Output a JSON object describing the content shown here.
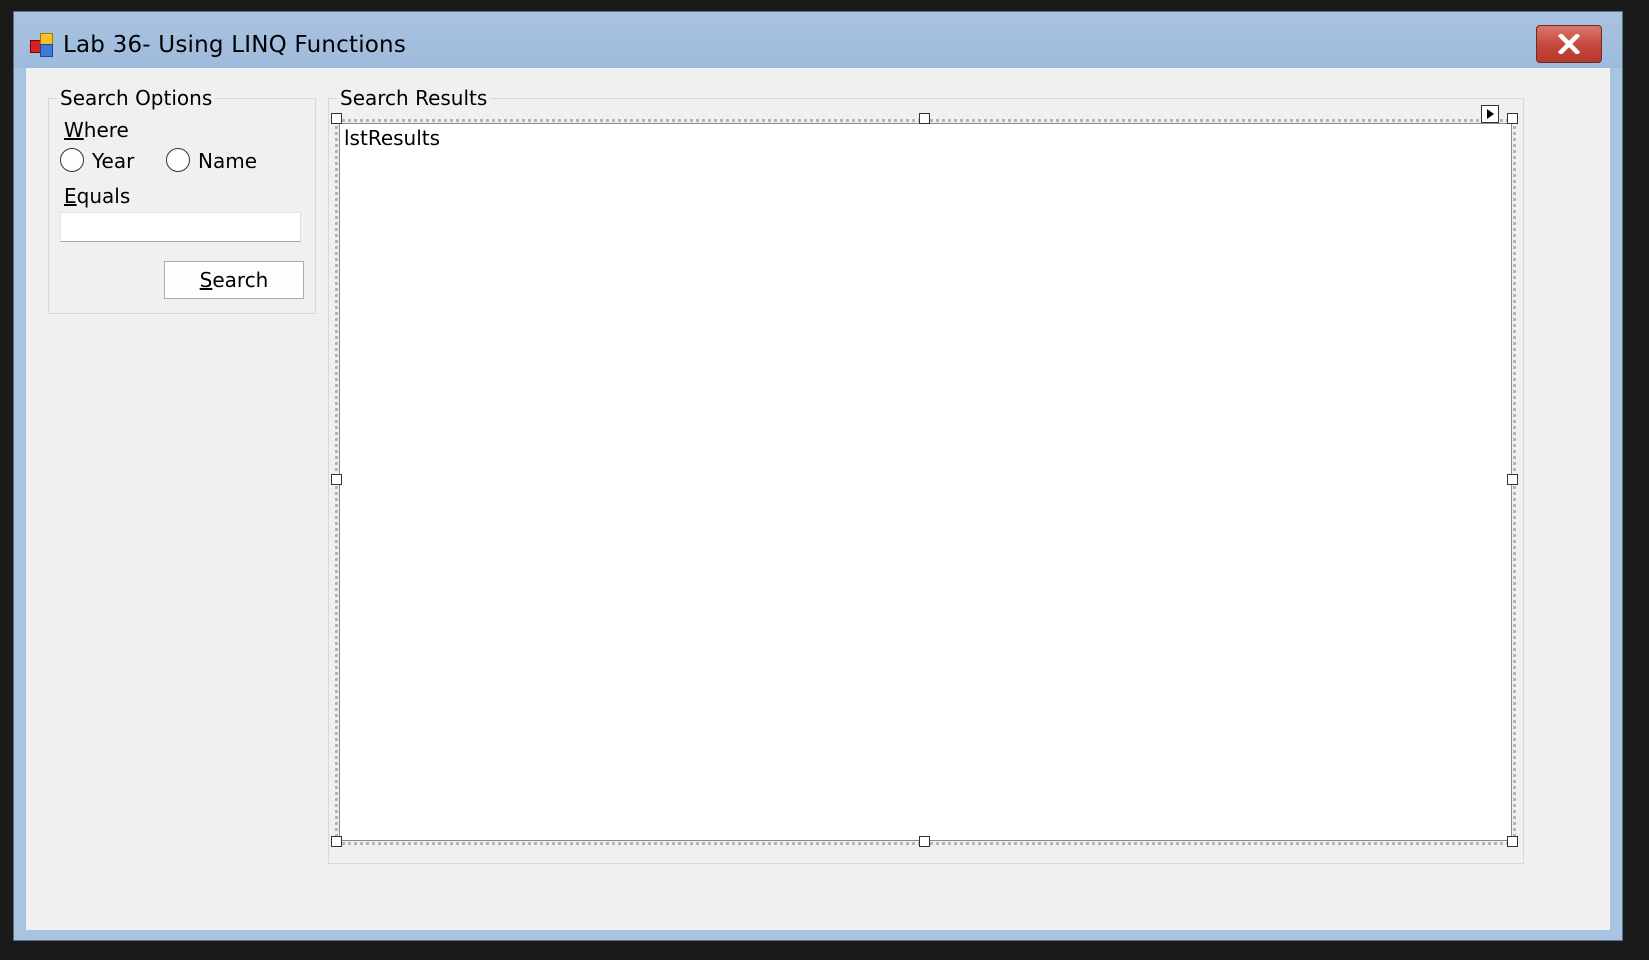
{
  "window": {
    "title": "Lab 36- Using LINQ Functions"
  },
  "search_options": {
    "group_title": "Search Options",
    "where_label_access": "W",
    "where_label_rest": "here",
    "radio_year": "Year",
    "radio_name": "Name",
    "equals_label_access": "E",
    "equals_label_rest": "quals",
    "equals_value": "",
    "search_button_access": "S",
    "search_button_rest": "earch"
  },
  "search_results": {
    "group_title": "Search Results",
    "listbox_name": "lstResults"
  },
  "colors": {
    "title_bar": "#a9c4e2",
    "client_area": "#f0f0f0",
    "close_button": "#c4463a"
  }
}
